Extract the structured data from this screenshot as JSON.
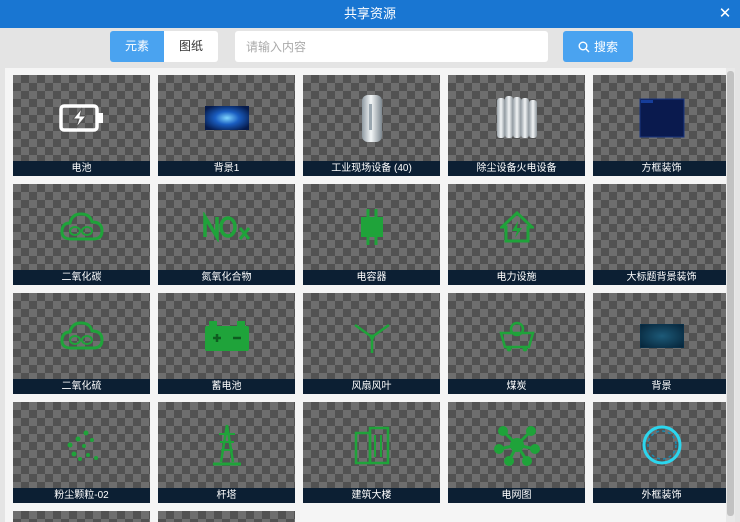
{
  "dialog": {
    "title": "共享资源",
    "close_glyph": "✕"
  },
  "tabs": [
    {
      "label": "元素",
      "active": true
    },
    {
      "label": "图纸",
      "active": false
    }
  ],
  "search": {
    "placeholder": "请输入内容",
    "value": "",
    "button_label": "搜索"
  },
  "colors": {
    "accent": "#4aa3f0",
    "titlebar": "#1976d2",
    "icon_green": "#1fa33a",
    "label_bg": "#0c1f33"
  },
  "items": [
    {
      "label": "电池",
      "icon": "battery-icon"
    },
    {
      "label": "背景1",
      "icon": "background-image-icon"
    },
    {
      "label": "工业现场设备 (40)",
      "icon": "industrial-cylinder-icon"
    },
    {
      "label": "除尘设备火电设备",
      "icon": "radiator-icon"
    },
    {
      "label": "方框装饰",
      "icon": "square-frame-icon"
    },
    {
      "label": "二氧化碳",
      "icon": "co2-cloud-icon"
    },
    {
      "label": "氮氧化合物",
      "icon": "nox-icon"
    },
    {
      "label": "电容器",
      "icon": "capacitor-icon"
    },
    {
      "label": "电力设施",
      "icon": "power-house-icon"
    },
    {
      "label": "大标题背景装饰",
      "icon": "title-decoration-icon"
    },
    {
      "label": "二氧化硫",
      "icon": "so2-cloud-icon"
    },
    {
      "label": "蓄电池",
      "icon": "storage-battery-icon"
    },
    {
      "label": "风扇风叶",
      "icon": "fan-blade-icon"
    },
    {
      "label": "煤炭",
      "icon": "coal-cart-icon"
    },
    {
      "label": "背景",
      "icon": "background-panel-icon"
    },
    {
      "label": "粉尘颗粒-02",
      "icon": "dust-particles-icon"
    },
    {
      "label": "杆塔",
      "icon": "tower-icon"
    },
    {
      "label": "建筑大楼",
      "icon": "building-icon"
    },
    {
      "label": "电网图",
      "icon": "grid-network-icon"
    },
    {
      "label": "外框装饰",
      "icon": "ring-frame-icon"
    }
  ]
}
